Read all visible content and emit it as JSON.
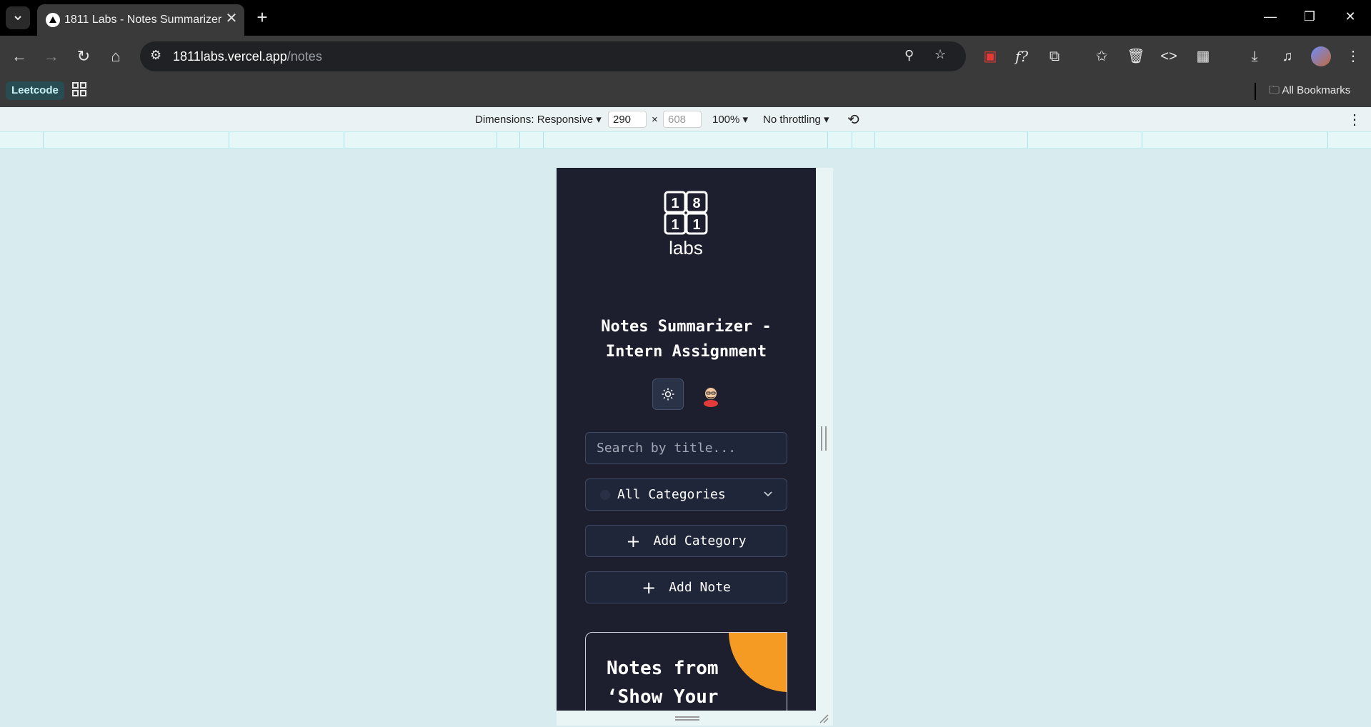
{
  "browser": {
    "tab_title": "1811 Labs - Notes Summarizer",
    "url_host": "1811labs.vercel.app",
    "url_path": "/notes",
    "bookmarks": {
      "leetcode": "Leetcode",
      "all_bookmarks": "All Bookmarks"
    }
  },
  "devtools": {
    "dimensions_label": "Dimensions: Responsive ▾",
    "width": "290",
    "height": "608",
    "x_sep": "×",
    "zoom": "100% ▾",
    "throttling": "No throttling ▾"
  },
  "app": {
    "logo_digits": [
      "1",
      "8",
      "1",
      "1"
    ],
    "logo_word": "labs",
    "title_line1": "Notes Summarizer -",
    "title_line2": "Intern Assignment",
    "search_placeholder": "Search by title...",
    "category_select": "All Categories",
    "add_category": "Add Category",
    "add_note": "Add Note",
    "note_card_title_line1": "Notes from",
    "note_card_title_line2": "‘Show Your"
  },
  "colors": {
    "app_background": "#1e1f2e",
    "accent_orange": "#f59a23",
    "browser_chrome": "#3a3a3a",
    "emulation_background": "#d8ebef"
  },
  "icons": [
    "chevron-down-icon",
    "close-icon",
    "plus-icon",
    "back-arrow-icon",
    "forward-arrow-icon",
    "reload-icon",
    "home-icon",
    "site-info-icon",
    "zoom-icon",
    "star-icon",
    "extension-icon",
    "download-icon",
    "sun-icon",
    "rotate-icon",
    "more-vert-icon"
  ]
}
